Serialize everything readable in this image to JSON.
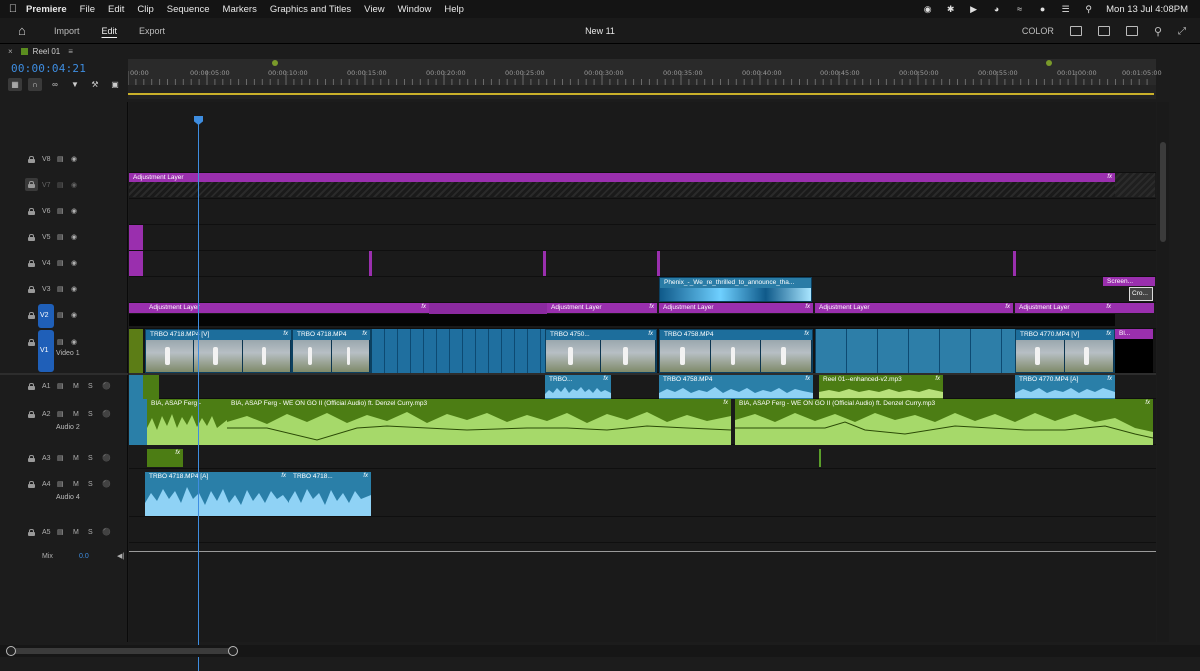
{
  "menubar": {
    "app": "Premiere",
    "items": [
      "File",
      "Edit",
      "Clip",
      "Sequence",
      "Markers",
      "Graphics and Titles",
      "View",
      "Window",
      "Help"
    ],
    "clock": "Mon 13 Jul  4:08PM"
  },
  "appheader": {
    "nav": [
      "Import",
      "Edit",
      "Export"
    ],
    "active_nav": "Edit",
    "title": "New 11",
    "color_label": "COLOR"
  },
  "timeline": {
    "sequence_name": "Reel 01",
    "timecode": "00:00:04:21",
    "ruler_labels": [
      "00:00",
      "00:00:05:00",
      "00:00:10:00",
      "00:00:15:00",
      "00:00:20:00",
      "00:00:25:00",
      "00:00:30:00",
      "00:00:35:00",
      "00:00:40:00",
      "00:00:45:00",
      "00:00:50:00",
      "00:00:55:00",
      "00:01:00:00",
      "00:01:05:00"
    ],
    "video_tracks": [
      {
        "name": "V8"
      },
      {
        "name": "V7"
      },
      {
        "name": "V6"
      },
      {
        "name": "V5"
      },
      {
        "name": "V4"
      },
      {
        "name": "V3"
      },
      {
        "name": "V2"
      },
      {
        "name": "V1",
        "sub": "Video 1"
      }
    ],
    "audio_tracks": [
      {
        "name": "A1"
      },
      {
        "name": "A2",
        "sub": "Audio 2"
      },
      {
        "name": "A3"
      },
      {
        "name": "A4",
        "sub": "Audio 4"
      },
      {
        "name": "A5"
      }
    ],
    "mix": {
      "label": "Mix",
      "value": "0.0"
    },
    "track_buttons": {
      "mute": "M",
      "solo": "S"
    },
    "clips": {
      "v7_adjust": "Adjustment Layer",
      "v3_phenix": "Phenix_-_We_re_thrilled_to_announce_tha...",
      "v3_screen": "Screen...",
      "v3_cro": "Cro...",
      "v2_adjust": "Adjustment Layer",
      "v1_a": "TRBO 4718.MP4 [V]",
      "v1_b": "TRBO 4718.MP4",
      "v1_c": "TRBO 4750...",
      "v1_d": "TRBO 4758.MP4",
      "v1_e": "TRBO 4770.MP4 [V]",
      "v1_f": "Bl...",
      "a1_a": "TRBO...",
      "a1_b": "TRBO 4758.MP4",
      "a1_c": "Reel 01--enhanced-v2.mp3",
      "a1_d": "TRBO 4770.MP4 [A]",
      "a2_a": "BIA, ASAP Ferg -",
      "a2_b": "BIA, ASAP Ferg - WE ON GO II (Official Audio) ft. Denzel Curry.mp3",
      "a2_c": "BIA, ASAP Ferg - WE ON GO II (Official Audio) ft. Denzel Curry.mp3",
      "a4_a": "TRBO 4718.MP4 [A]",
      "a4_b": "TRBO 4718..."
    },
    "fx": "fx"
  }
}
